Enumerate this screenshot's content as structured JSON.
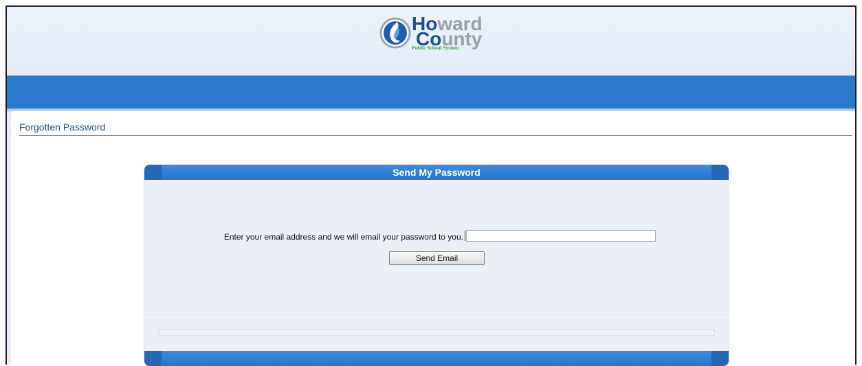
{
  "logo": {
    "line1": "Howard",
    "line2": "County",
    "tagline": "Public School System"
  },
  "page": {
    "title": "Forgotten Password"
  },
  "panel": {
    "title": "Send My Password",
    "prompt": "Enter your email address and we will email your password to you.",
    "email_value": "",
    "email_placeholder": "",
    "button_label": "Send Email"
  },
  "colors": {
    "brand_blue": "#2b79cc",
    "title_blue": "#1d4f86",
    "logo_green": "#3a9a3a",
    "logo_gray": "#9aa0a6"
  },
  "icons": {
    "logo_mark": "flame-globe-icon"
  }
}
